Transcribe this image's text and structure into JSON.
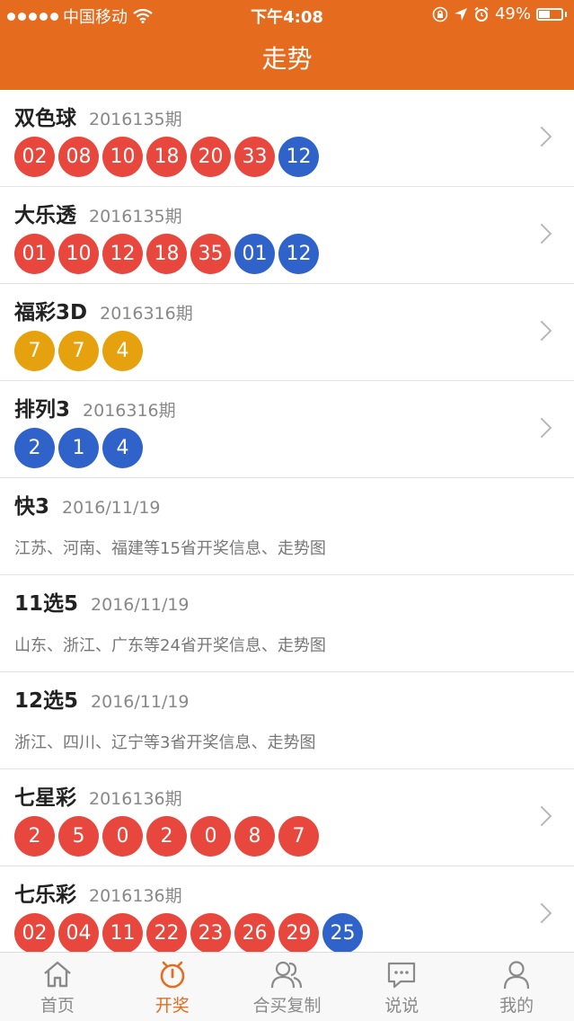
{
  "status_bar": {
    "carrier": "中国移动",
    "time": "下午4:08",
    "battery": "49%",
    "battery_level": 0.49
  },
  "header": {
    "title": "走势"
  },
  "colors": {
    "accent": "#e56b1f",
    "ball_red": "#e8473d",
    "ball_blue": "#2f63c9",
    "ball_gold": "#e6a10e"
  },
  "lotteries": [
    {
      "name": "双色球",
      "issue": "2016135期",
      "balls": [
        {
          "n": "02",
          "c": "red"
        },
        {
          "n": "08",
          "c": "red"
        },
        {
          "n": "10",
          "c": "red"
        },
        {
          "n": "18",
          "c": "red"
        },
        {
          "n": "20",
          "c": "red"
        },
        {
          "n": "33",
          "c": "red"
        },
        {
          "n": "12",
          "c": "blue"
        }
      ]
    },
    {
      "name": "大乐透",
      "issue": "2016135期",
      "balls": [
        {
          "n": "01",
          "c": "red"
        },
        {
          "n": "10",
          "c": "red"
        },
        {
          "n": "12",
          "c": "red"
        },
        {
          "n": "18",
          "c": "red"
        },
        {
          "n": "35",
          "c": "red"
        },
        {
          "n": "01",
          "c": "blue"
        },
        {
          "n": "12",
          "c": "blue"
        }
      ]
    },
    {
      "name": "福彩3D",
      "issue": "2016316期",
      "balls": [
        {
          "n": "7",
          "c": "gold"
        },
        {
          "n": "7",
          "c": "gold"
        },
        {
          "n": "4",
          "c": "gold"
        }
      ]
    },
    {
      "name": "排列3",
      "issue": "2016316期",
      "balls": [
        {
          "n": "2",
          "c": "blue"
        },
        {
          "n": "1",
          "c": "blue"
        },
        {
          "n": "4",
          "c": "blue"
        }
      ]
    },
    {
      "name": "快3",
      "issue": "2016/11/19",
      "desc": "江苏、河南、福建等15省开奖信息、走势图"
    },
    {
      "name": "11选5",
      "issue": "2016/11/19",
      "desc": "山东、浙江、广东等24省开奖信息、走势图"
    },
    {
      "name": "12选5",
      "issue": "2016/11/19",
      "desc": "浙江、四川、辽宁等3省开奖信息、走势图"
    },
    {
      "name": "七星彩",
      "issue": "2016136期",
      "balls": [
        {
          "n": "2",
          "c": "red"
        },
        {
          "n": "5",
          "c": "red"
        },
        {
          "n": "0",
          "c": "red"
        },
        {
          "n": "2",
          "c": "red"
        },
        {
          "n": "0",
          "c": "red"
        },
        {
          "n": "8",
          "c": "red"
        },
        {
          "n": "7",
          "c": "red"
        }
      ]
    },
    {
      "name": "七乐彩",
      "issue": "2016136期",
      "balls": [
        {
          "n": "02",
          "c": "red"
        },
        {
          "n": "04",
          "c": "red"
        },
        {
          "n": "11",
          "c": "red"
        },
        {
          "n": "22",
          "c": "red"
        },
        {
          "n": "23",
          "c": "red"
        },
        {
          "n": "26",
          "c": "red"
        },
        {
          "n": "29",
          "c": "red"
        },
        {
          "n": "25",
          "c": "blue"
        }
      ]
    }
  ],
  "tabs": [
    {
      "label": "首页",
      "icon": "home-icon"
    },
    {
      "label": "开奖",
      "icon": "alarm-clock-icon",
      "active": true
    },
    {
      "label": "合买复制",
      "icon": "users-icon"
    },
    {
      "label": "说说",
      "icon": "chat-icon"
    },
    {
      "label": "我的",
      "icon": "person-icon"
    }
  ]
}
